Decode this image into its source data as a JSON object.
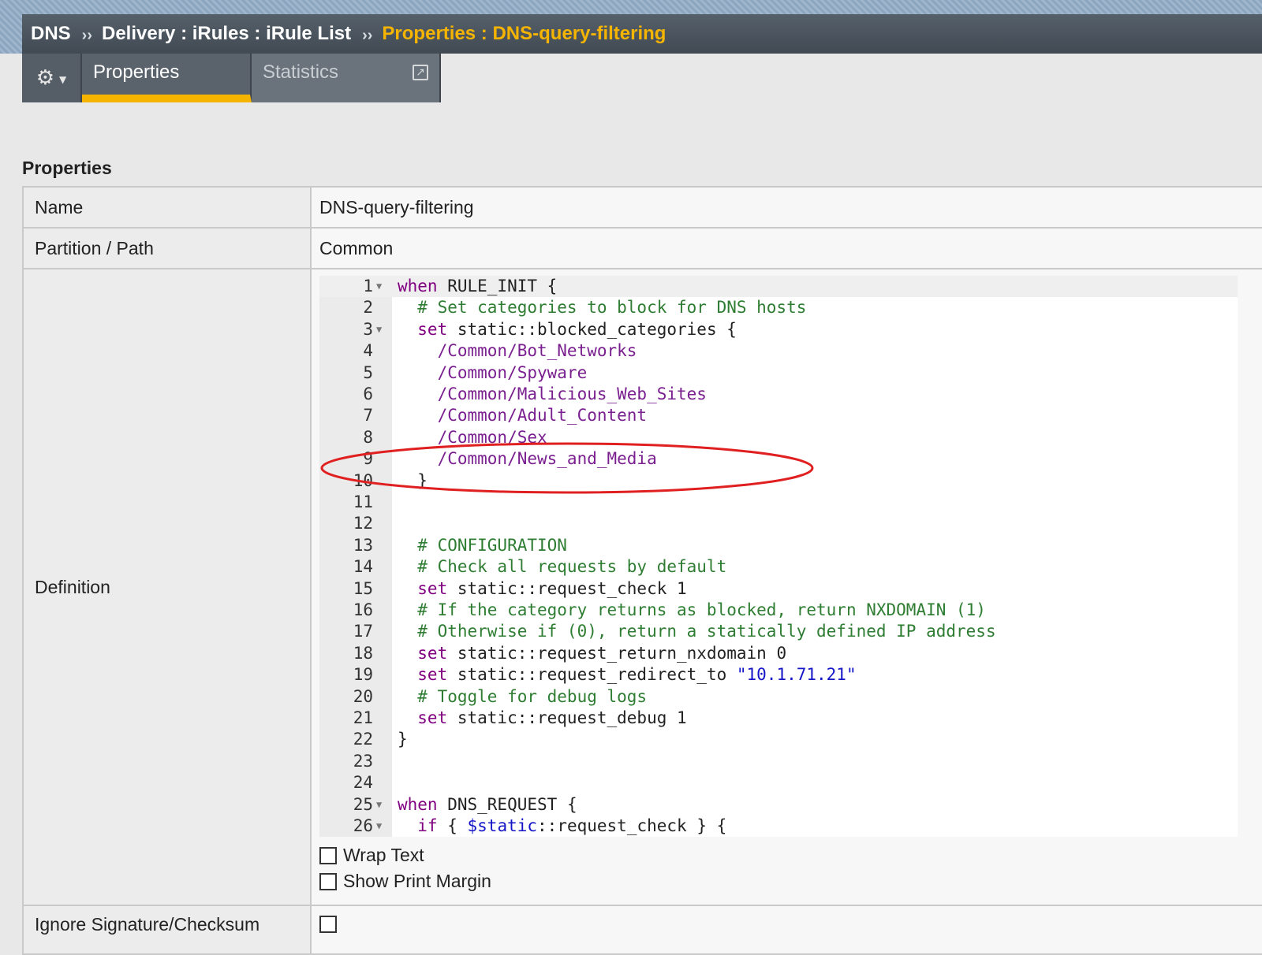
{
  "breadcrumb": {
    "items": [
      "DNS",
      "Delivery : iRules : iRule List"
    ],
    "separator": "››",
    "current": "Properties : DNS-query-filtering"
  },
  "tabs": {
    "gear_icon": "gear-icon",
    "items": [
      {
        "label": "Properties",
        "active": true
      },
      {
        "label": "Statistics",
        "active": false
      }
    ]
  },
  "section": {
    "title": "Properties"
  },
  "properties": {
    "name_label": "Name",
    "name_value": "DNS-query-filtering",
    "partition_label": "Partition / Path",
    "partition_value": "Common",
    "definition_label": "Definition",
    "ignore_label": "Ignore Signature/Checksum"
  },
  "code": {
    "lines": [
      {
        "n": "1",
        "fold": true,
        "tokens": [
          {
            "t": "kw",
            "v": "when"
          },
          {
            "t": "pl",
            "v": " RULE_INIT {"
          }
        ]
      },
      {
        "n": "2",
        "tokens": [
          {
            "t": "cm",
            "v": "  # Set categories to block for DNS hosts"
          }
        ]
      },
      {
        "n": "3",
        "fold": true,
        "tokens": [
          {
            "t": "kw",
            "v": "  set"
          },
          {
            "t": "pl",
            "v": " static::blocked_categories {"
          }
        ]
      },
      {
        "n": "4",
        "tokens": [
          {
            "t": "pth",
            "v": "    /Common/Bot_Networks"
          }
        ]
      },
      {
        "n": "5",
        "tokens": [
          {
            "t": "pth",
            "v": "    /Common/Spyware"
          }
        ]
      },
      {
        "n": "6",
        "tokens": [
          {
            "t": "pth",
            "v": "    /Common/Malicious_Web_Sites"
          }
        ]
      },
      {
        "n": "7",
        "tokens": [
          {
            "t": "pth",
            "v": "    /Common/Adult_Content"
          }
        ]
      },
      {
        "n": "8",
        "tokens": [
          {
            "t": "pth",
            "v": "    /Common/Sex"
          }
        ]
      },
      {
        "n": "9",
        "tokens": [
          {
            "t": "pth",
            "v": "    /Common/News_and_Media"
          }
        ]
      },
      {
        "n": "10",
        "tokens": [
          {
            "t": "pl",
            "v": "  }"
          }
        ]
      },
      {
        "n": "11",
        "tokens": []
      },
      {
        "n": "12",
        "tokens": []
      },
      {
        "n": "13",
        "tokens": [
          {
            "t": "cm",
            "v": "  # CONFIGURATION"
          }
        ]
      },
      {
        "n": "14",
        "tokens": [
          {
            "t": "cm",
            "v": "  # Check all requests by default"
          }
        ]
      },
      {
        "n": "15",
        "tokens": [
          {
            "t": "kw",
            "v": "  set"
          },
          {
            "t": "pl",
            "v": " static::request_check 1"
          }
        ]
      },
      {
        "n": "16",
        "tokens": [
          {
            "t": "cm",
            "v": "  # If the category returns as blocked, return NXDOMAIN (1)"
          }
        ]
      },
      {
        "n": "17",
        "tokens": [
          {
            "t": "cm",
            "v": "  # Otherwise if (0), return a statically defined IP address"
          }
        ]
      },
      {
        "n": "18",
        "tokens": [
          {
            "t": "kw",
            "v": "  set"
          },
          {
            "t": "pl",
            "v": " static::request_return_nxdomain 0"
          }
        ]
      },
      {
        "n": "19",
        "tokens": [
          {
            "t": "kw",
            "v": "  set"
          },
          {
            "t": "pl",
            "v": " static::request_redirect_to "
          },
          {
            "t": "str",
            "v": "\"10.1.71.21\""
          }
        ]
      },
      {
        "n": "20",
        "tokens": [
          {
            "t": "cm",
            "v": "  # Toggle for debug logs"
          }
        ]
      },
      {
        "n": "21",
        "tokens": [
          {
            "t": "kw",
            "v": "  set"
          },
          {
            "t": "pl",
            "v": " static::request_debug 1"
          }
        ]
      },
      {
        "n": "22",
        "tokens": [
          {
            "t": "pl",
            "v": "}"
          }
        ]
      },
      {
        "n": "23",
        "tokens": []
      },
      {
        "n": "24",
        "tokens": []
      },
      {
        "n": "25",
        "fold": true,
        "tokens": [
          {
            "t": "kw",
            "v": "when"
          },
          {
            "t": "pl",
            "v": " DNS_REQUEST {"
          }
        ]
      },
      {
        "n": "26",
        "fold": true,
        "tokens": [
          {
            "t": "kw",
            "v": "  if"
          },
          {
            "t": "pl",
            "v": " { "
          },
          {
            "t": "str",
            "v": "$static"
          },
          {
            "t": "pl",
            "v": "::request_check } {"
          }
        ]
      }
    ]
  },
  "options": {
    "wrap_text": "Wrap Text",
    "show_print_margin": "Show Print Margin"
  },
  "colors": {
    "accent": "#f5b400",
    "highlight_ring": "#e02020"
  }
}
